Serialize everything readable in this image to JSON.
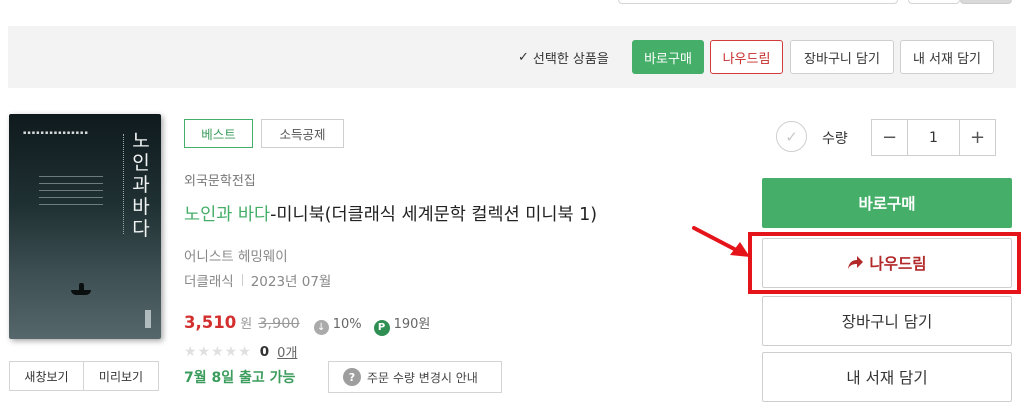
{
  "selection_bar": {
    "label": "선택한 상품을",
    "buttons": {
      "buy": "바로구매",
      "give": "나우드림",
      "cart": "장바구니 담기",
      "shelf": "내 서재 담기"
    }
  },
  "book": {
    "cover_title": "노인과바다",
    "tags": {
      "best": "베스트",
      "tax": "소득공제"
    },
    "category": "외국문학전집",
    "title_highlight": "노인과 바다",
    "title_rest": "-미니북(더클래식 세계문학 컬렉션 미니북 1)",
    "author": "어니스트 헤밍웨이",
    "publisher": "더클래식",
    "pub_date": "2023년 07월",
    "price": "3,510",
    "currency": "원",
    "original_price": "3,900",
    "discount": "10%",
    "points_badge": "P",
    "points": "190원",
    "stars": "★★★★★",
    "rating_count": "0",
    "review_link": "0개",
    "shipping": "7월 8일 출고 가능",
    "notice_label": "주문 수량 변경시 안내",
    "new_window": "새창보기",
    "preview": "미리보기"
  },
  "purchase": {
    "quantity_label": "수량",
    "quantity_value": "1",
    "minus": "−",
    "plus": "+",
    "buy": "바로구매",
    "give": "나우드림",
    "cart": "장바구니 담기",
    "shelf": "내 서재 담기"
  },
  "colors": {
    "accent_green": "#45ae68",
    "price_red": "#d32f2f",
    "highlight_red": "#e4141a"
  },
  "icons": {
    "check": "check-icon",
    "discount": "discount-icon",
    "points": "points-icon",
    "question": "question-icon",
    "share": "share-arrow-icon",
    "pointer": "red-arrow-icon"
  }
}
